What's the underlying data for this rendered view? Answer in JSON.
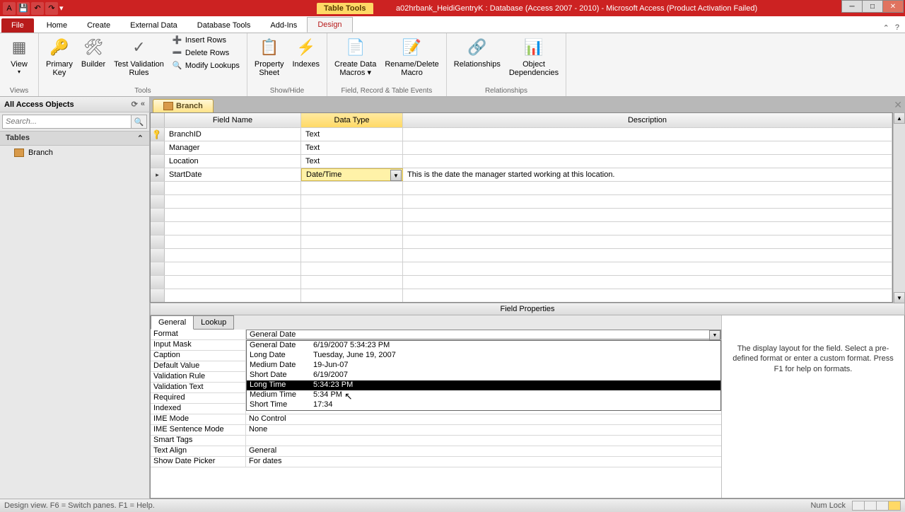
{
  "titlebar": {
    "context_tab": "Table Tools",
    "title": "a02hrbank_HeidiGentryK : Database (Access 2007 - 2010)  -  Microsoft Access (Product Activation Failed)"
  },
  "ribbon_tabs": {
    "file": "File",
    "items": [
      "Home",
      "Create",
      "External Data",
      "Database Tools",
      "Add-Ins",
      "Design"
    ]
  },
  "ribbon": {
    "views": {
      "view": "View",
      "group": "Views"
    },
    "tools": {
      "primary_key": "Primary\nKey",
      "builder": "Builder",
      "test_rules": "Test Validation\nRules",
      "insert_rows": "Insert Rows",
      "delete_rows": "Delete Rows",
      "modify_lookups": "Modify Lookups",
      "group": "Tools"
    },
    "showhide": {
      "property_sheet": "Property\nSheet",
      "indexes": "Indexes",
      "group": "Show/Hide"
    },
    "events": {
      "create_macros": "Create Data\nMacros ▾",
      "rename_delete": "Rename/Delete\nMacro",
      "group": "Field, Record & Table Events"
    },
    "relationships": {
      "relationships": "Relationships",
      "object_deps": "Object\nDependencies",
      "group": "Relationships"
    }
  },
  "navpane": {
    "header": "All Access Objects",
    "search_placeholder": "Search...",
    "group": "Tables",
    "items": [
      "Branch"
    ]
  },
  "doc_tab": "Branch",
  "grid": {
    "headers": {
      "field_name": "Field Name",
      "data_type": "Data Type",
      "description": "Description"
    },
    "rows": [
      {
        "name": "BranchID",
        "type": "Text",
        "desc": "",
        "pk": true
      },
      {
        "name": "Manager",
        "type": "Text",
        "desc": ""
      },
      {
        "name": "Location",
        "type": "Text",
        "desc": ""
      },
      {
        "name": "StartDate",
        "type": "Date/Time",
        "desc": "This is the date the manager started working at this location.",
        "selected": true
      }
    ]
  },
  "field_properties_label": "Field Properties",
  "prop_tabs": {
    "general": "General",
    "lookup": "Lookup"
  },
  "props": [
    {
      "label": "Format",
      "value": "General Date"
    },
    {
      "label": "Input Mask",
      "value": ""
    },
    {
      "label": "Caption",
      "value": ""
    },
    {
      "label": "Default Value",
      "value": ""
    },
    {
      "label": "Validation Rule",
      "value": ""
    },
    {
      "label": "Validation Text",
      "value": ""
    },
    {
      "label": "Required",
      "value": ""
    },
    {
      "label": "Indexed",
      "value": ""
    },
    {
      "label": "IME Mode",
      "value": "No Control"
    },
    {
      "label": "IME Sentence Mode",
      "value": "None"
    },
    {
      "label": "Smart Tags",
      "value": ""
    },
    {
      "label": "Text Align",
      "value": "General"
    },
    {
      "label": "Show Date Picker",
      "value": "For dates"
    }
  ],
  "format_options": [
    {
      "name": "General Date",
      "example": "6/19/2007 5:34:23 PM"
    },
    {
      "name": "Long Date",
      "example": "Tuesday, June 19, 2007"
    },
    {
      "name": "Medium Date",
      "example": "19-Jun-07"
    },
    {
      "name": "Short Date",
      "example": "6/19/2007"
    },
    {
      "name": "Long Time",
      "example": "5:34:23 PM",
      "selected": true
    },
    {
      "name": "Medium Time",
      "example": "5:34 PM"
    },
    {
      "name": "Short Time",
      "example": "17:34"
    }
  ],
  "help_text": "The display layout for the field. Select a pre-defined format or enter a custom format. Press F1 for help on formats.",
  "statusbar": {
    "left": "Design view.   F6 = Switch panes.   F1 = Help.",
    "numlock": "Num Lock"
  }
}
